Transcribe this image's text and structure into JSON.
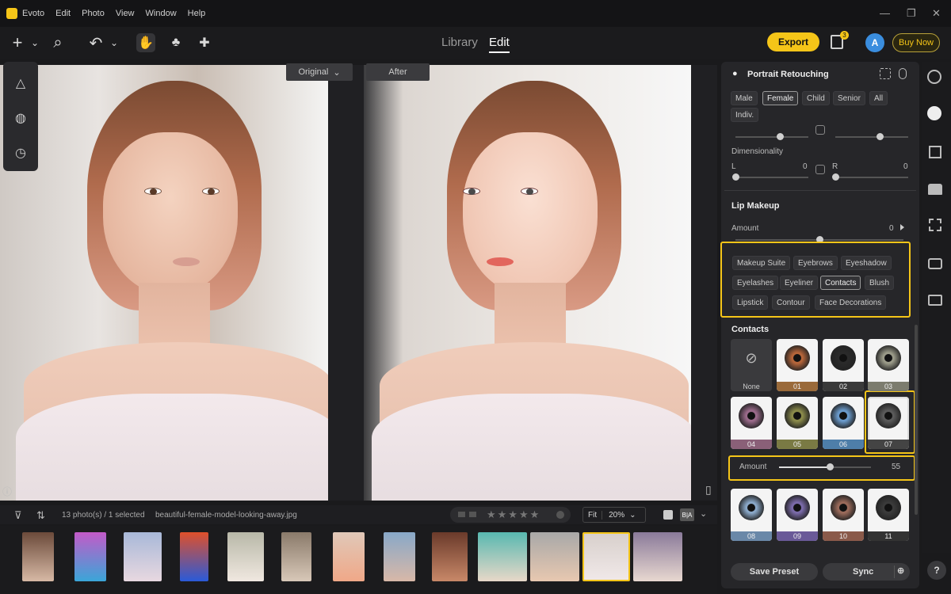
{
  "app": {
    "name": "Evoto"
  },
  "menu": [
    "Edit",
    "Photo",
    "View",
    "Window",
    "Help"
  ],
  "window_controls": {
    "minimize": "—",
    "maximize": "❐",
    "close": "✕"
  },
  "toolbar": {
    "add_icon": "+",
    "chevron": "⌄",
    "search_icon": "⌕",
    "undo_icon": "↶",
    "hand_icon": "✋",
    "brush_icon": "♣",
    "heal_icon": "✚"
  },
  "mode_tabs": {
    "library": "Library",
    "edit": "Edit"
  },
  "header_actions": {
    "export": "Export",
    "queue_badge": "3",
    "avatar": "A",
    "buy_now": "Buy Now"
  },
  "left_tools": {
    "adjust_icon": "△",
    "filter_icon": "◍",
    "history_icon": "◷"
  },
  "canvas": {
    "original_label": "Original",
    "original_chevron": "⌄",
    "after_label": "After",
    "compare_icon": "▯",
    "info_icon": "ⓘ"
  },
  "panel": {
    "title": "Portrait Retouching",
    "title_icon": "●",
    "gender_tabs": [
      "Male",
      "Female",
      "Child",
      "Senior",
      "All",
      "Indiv."
    ],
    "selected_gender": "Female",
    "dimensionality": {
      "label": "Dimensionality",
      "left_label": "L",
      "left_value": "0",
      "right_label": "R",
      "right_value": "0"
    },
    "lip_makeup": {
      "title": "Lip Makeup",
      "amount_label": "Amount",
      "amount_value": "0"
    },
    "makeup_tabs": [
      "Makeup Suite",
      "Eyebrows",
      "Eyeshadow",
      "Eyelashes",
      "Eyeliner",
      "Contacts",
      "Blush",
      "Lipstick",
      "Contour",
      "Face Decorations"
    ],
    "selected_makeup_tab": "Contacts",
    "contacts": {
      "title": "Contacts",
      "none_label": "None",
      "none_icon": "⊘",
      "items": [
        {
          "id": "01",
          "color": "#b5653a",
          "band": "#9a6a3a"
        },
        {
          "id": "02",
          "color": "#2a2a2a",
          "band": "#3a3a3a"
        },
        {
          "id": "03",
          "color": "#9a9a88",
          "band": "#7c7c6e"
        },
        {
          "id": "04",
          "color": "#9a6a8a",
          "band": "#8a6078"
        },
        {
          "id": "05",
          "color": "#8a8a4a",
          "band": "#7a7a44"
        },
        {
          "id": "06",
          "color": "#6a9acb",
          "band": "#4e7ea9"
        },
        {
          "id": "07",
          "color": "#5a5a5a",
          "band": "#444444"
        },
        {
          "id": "08",
          "color": "#8aa8c8",
          "band": "#6a88a8"
        },
        {
          "id": "09",
          "color": "#7a6aa8",
          "band": "#6a5a98"
        },
        {
          "id": "10",
          "color": "#9a6a5a",
          "band": "#8a5a4a"
        },
        {
          "id": "11",
          "color": "#3a3a3a",
          "band": "#333333"
        }
      ],
      "selected": "07",
      "amount_label": "Amount",
      "amount_value": "55",
      "amount": 55
    },
    "save_preset": "Save Preset",
    "sync": "Sync",
    "sync_plus_icon": "⊕"
  },
  "right_tools": [
    "palette-icon",
    "face-icon",
    "grid-icon",
    "shirt-icon",
    "crop-icon",
    "camera-icon",
    "folder-icon"
  ],
  "filmbar": {
    "filter_icon": "⊽",
    "sort_icon": "⇅",
    "count": "13 photo(s) / 1 selected",
    "filename": "beautiful-female-model-looking-away.jpg",
    "stars": "★★★★★",
    "fit_label": "Fit",
    "zoom": "20%",
    "ba_label": "B|A"
  },
  "colors": {
    "accent": "#f5c518",
    "panel_bg": "#262629",
    "app_bg": "#1a1a1c"
  }
}
